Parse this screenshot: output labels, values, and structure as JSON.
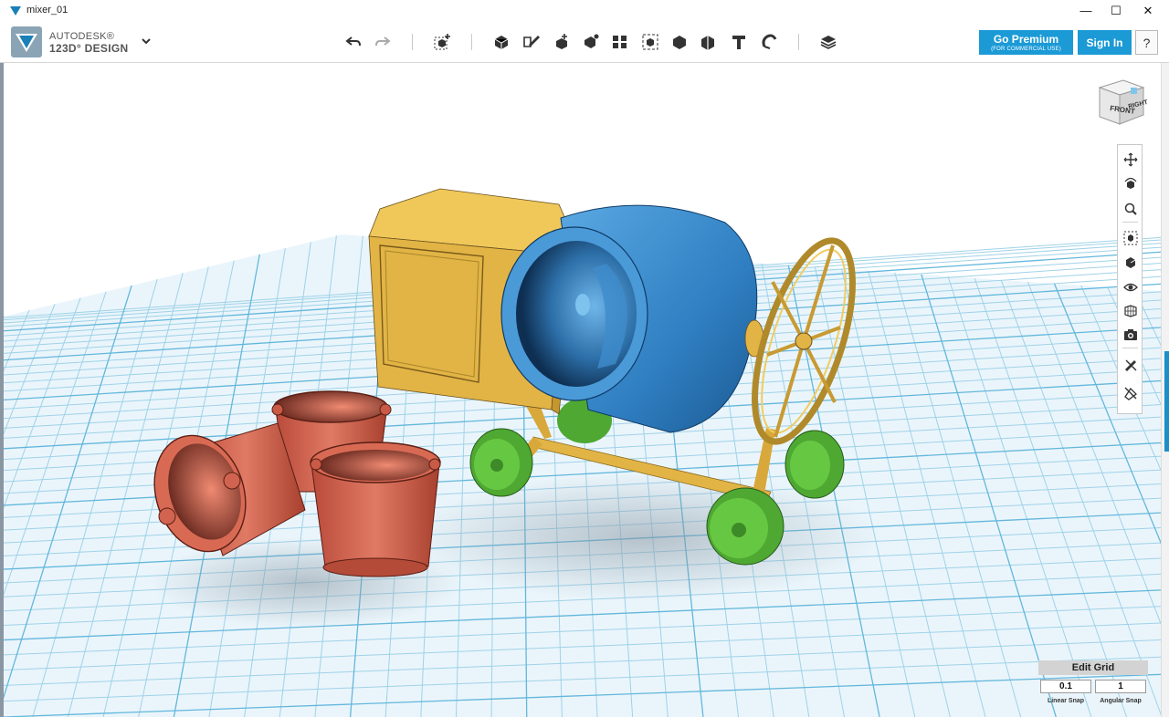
{
  "window": {
    "title": "mixer_01",
    "controls": {
      "minimize": "—",
      "maximize": "☐",
      "close": "✕"
    }
  },
  "app": {
    "brand_line1": "AUTODESK®",
    "brand_line2": "123D° DESIGN"
  },
  "toolbar": {
    "icons": [
      "undo-icon",
      "redo-icon",
      "transform-icon",
      "primitives-icon",
      "sketch-icon",
      "construct-icon",
      "modify-icon",
      "pattern-icon",
      "grouping-icon",
      "combine-icon",
      "measure-icon",
      "text-icon",
      "snap-icon",
      "material-icon"
    ]
  },
  "account": {
    "go_premium": "Go Premium",
    "go_premium_sub": "(FOR COMMERCIAL USE)",
    "sign_in": "Sign In",
    "help": "?"
  },
  "viewcube": {
    "front": "FRONT",
    "right": "RIGHT"
  },
  "nav_panel": {
    "icons": [
      "pan-icon",
      "orbit-icon",
      "zoom-icon",
      "fit-icon",
      "view-icon",
      "visibility-icon",
      "materials-outline-icon",
      "snapshot-icon",
      "hide-sketch-icon",
      "hide-mesh-icon"
    ]
  },
  "edit_grid": {
    "label": "Edit Grid",
    "linear_snap_value": "0.1",
    "angular_snap_value": "1",
    "linear_snap_label": "Linear Snap",
    "angular_snap_label": "Angular Snap"
  },
  "colors": {
    "accent": "#1b9ad6",
    "grid_line": "#8ccbe4",
    "grid_bg": "#e6f4fa",
    "drum": "#3d8fd0",
    "body": "#e2b445",
    "wheel": "#5cbc3c",
    "bucket": "#d0604c"
  }
}
